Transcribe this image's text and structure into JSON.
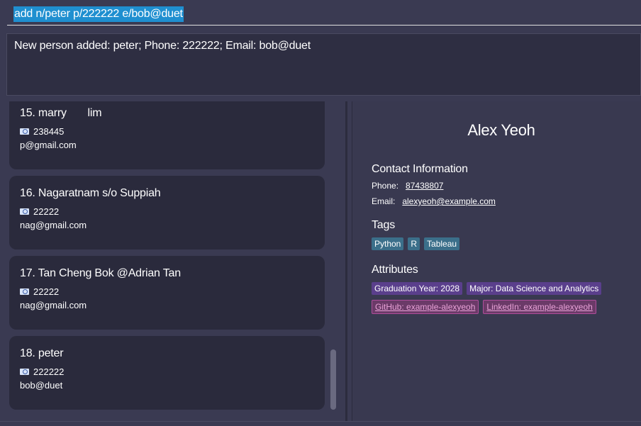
{
  "command": {
    "value": "add n/peter p/222222 e/bob@duet"
  },
  "result": {
    "message": "New person added: peter; Phone: 222222; Email: bob@duet"
  },
  "persons": [
    {
      "name": "15. marry       lim",
      "phone": "238445",
      "email": "p@gmail.com"
    },
    {
      "name": "16. Nagaratnam s/o Suppiah",
      "phone": "22222",
      "email": "nag@gmail.com"
    },
    {
      "name": "17. Tan Cheng Bok @Adrian Tan",
      "phone": "22222",
      "email": "nag@gmail.com"
    },
    {
      "name": "18. peter",
      "phone": "222222",
      "email": "bob@duet"
    }
  ],
  "detail": {
    "name": "Alex Yeoh",
    "contact_heading": "Contact Information",
    "phone_label": "Phone:",
    "phone": "87438807",
    "email_label": "Email:",
    "email": "alexyeoh@example.com",
    "tags_heading": "Tags",
    "tags": [
      "Python",
      "R",
      "Tableau"
    ],
    "attributes_heading": "Attributes",
    "attributes": [
      "Graduation Year: 2028",
      "Major: Data Science and Analytics"
    ],
    "link_attributes": [
      "GitHub: example-alexyeoh",
      "LinkedIn: example-alexyeoh"
    ]
  },
  "icons": {
    "phone": "phone-icon"
  },
  "colors": {
    "background": "#3a3a52",
    "card": "#2a2a3c",
    "selection": "#1f8fd0",
    "tag": "#3b6f8a",
    "attribute": "#5a3f8c",
    "link_attribute": "#6b3a68"
  }
}
